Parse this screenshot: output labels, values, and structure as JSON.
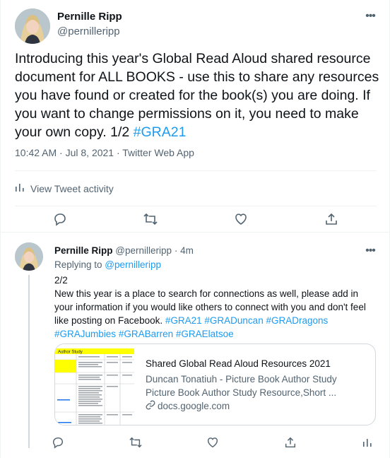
{
  "main_tweet": {
    "author_name": "Pernille Ripp",
    "author_handle": "@pernilleripp",
    "text": "Introducing this year's Global Read Aloud shared resource document for ALL BOOKS - use this to share any resources you have found or created for the book(s) you are doing.  If you want to change permissions on it, you need to make your own copy.  1/2 ",
    "hashtag": "#GRA21",
    "timestamp": "10:42 AM · Jul 8, 2021 · Twitter Web App",
    "activity_label": "View Tweet activity"
  },
  "reply_tweet": {
    "author_name": "Pernille Ripp",
    "author_handle": "@pernilleripp",
    "time": "4m",
    "replying_prefix": "Replying to ",
    "replying_to": "@pernilleripp",
    "line1": "2/2",
    "text": "New this year is a place to search for connections as well, please add in your information if you would like others to connect with you and don't feel like posting on Facebook. ",
    "hashtags": [
      "#GRA21",
      "#GRADuncan",
      "#GRADragons",
      "#GRAJumbies",
      "#GRABarren",
      "#GRAElatsoe"
    ],
    "card": {
      "title": "Shared Global Read Aloud Resources 2021",
      "desc_line1": "Duncan Tonatiuh - Picture Book Author Study",
      "desc_line2": "Picture Book Author Study Resource,Short ...",
      "domain": "docs.google.com",
      "thumb_header": "Author Study"
    }
  },
  "colors": {
    "link": "#1d9bf0",
    "secondary_text": "#536471",
    "border": "#eff3f4",
    "thumb_highlight": "#ffff00"
  },
  "icons": [
    "more-icon",
    "activity-icon",
    "reply-icon",
    "retweet-icon",
    "like-icon",
    "share-icon",
    "link-icon"
  ]
}
